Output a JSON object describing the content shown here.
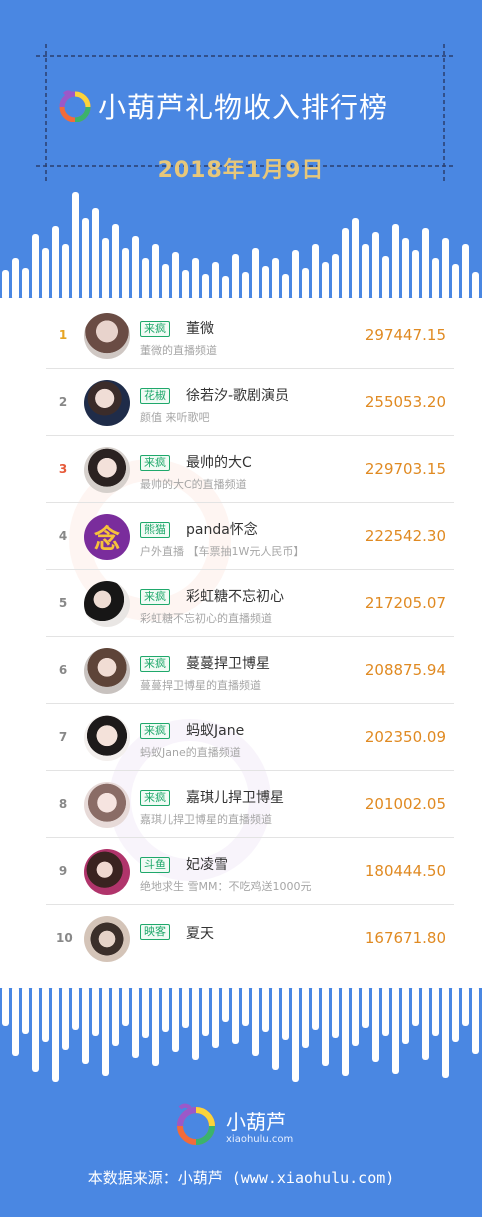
{
  "header": {
    "title": "小葫芦礼物收入排行榜",
    "date": "2018年1月9日"
  },
  "rows": [
    {
      "rank": "1",
      "badge": "来疯",
      "name": "董微",
      "subtitle": "董微的直播频道",
      "amount": "297447.15"
    },
    {
      "rank": "2",
      "badge": "花椒",
      "name": "徐若汐-歌剧演员",
      "subtitle": "颜值 来听歌吧",
      "amount": "255053.20"
    },
    {
      "rank": "3",
      "badge": "来疯",
      "name": "最帅的大C",
      "subtitle": "最帅的大C的直播频道",
      "amount": "229703.15"
    },
    {
      "rank": "4",
      "badge": "熊猫",
      "name": "panda怀念",
      "subtitle": "户外直播 【车票抽1W元人民币】",
      "amount": "222542.30"
    },
    {
      "rank": "5",
      "badge": "来疯",
      "name": "彩虹糖不忘初心",
      "subtitle": "彩虹糖不忘初心的直播频道",
      "amount": "217205.07"
    },
    {
      "rank": "6",
      "badge": "来疯",
      "name": "蔓蔓捍卫博星",
      "subtitle": "蔓蔓捍卫博星的直播频道",
      "amount": "208875.94"
    },
    {
      "rank": "7",
      "badge": "来疯",
      "name": "蚂蚁Jane",
      "subtitle": "蚂蚁Jane的直播频道",
      "amount": "202350.09"
    },
    {
      "rank": "8",
      "badge": "来疯",
      "name": "嘉琪儿捍卫博星",
      "subtitle": "嘉琪儿捍卫博星的直播频道",
      "amount": "201002.05"
    },
    {
      "rank": "9",
      "badge": "斗鱼",
      "name": "妃凌雪",
      "subtitle": "绝地求生 雪MM：不吃鸡送1000元",
      "amount": "180444.50"
    },
    {
      "rank": "10",
      "badge": "映客",
      "name": "夏天",
      "subtitle": "",
      "amount": "167671.80"
    }
  ],
  "footer": {
    "brand": "小葫芦",
    "url": "xiaohulu.com",
    "source": "本数据来源：小葫芦 (www.xiaohulu.com)"
  },
  "colors": {
    "background": "#4a87e2",
    "amount": "#e08a22",
    "badge": "#1fa86b",
    "date": "#e7c77a"
  }
}
